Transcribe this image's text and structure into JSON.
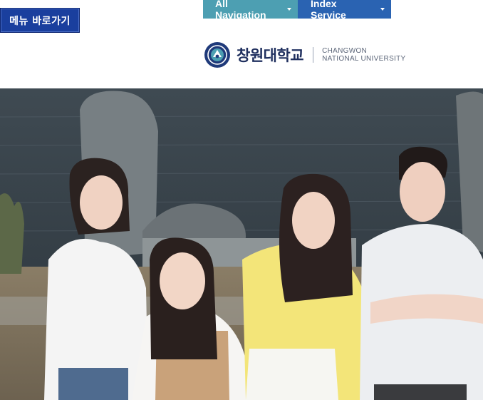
{
  "skip_link": {
    "label": "메뉴 바로가기"
  },
  "top_nav": {
    "items": [
      {
        "label": "All Navigation",
        "icon": "caret-down-icon"
      },
      {
        "label": "Index Service",
        "icon": "caret-down-icon"
      }
    ]
  },
  "logo": {
    "name_ko": "창원대학교",
    "name_en_line1": "CHANGWON",
    "name_en_line2": "NATIONAL UNIVERSITY",
    "emblem_icon": "university-emblem-icon"
  },
  "colors": {
    "skip_link_bg": "#1a3f9e",
    "nav_all_bg": "#4d9fb2",
    "nav_index_bg": "#2a63b2",
    "logo_text": "#1f2f5e"
  }
}
